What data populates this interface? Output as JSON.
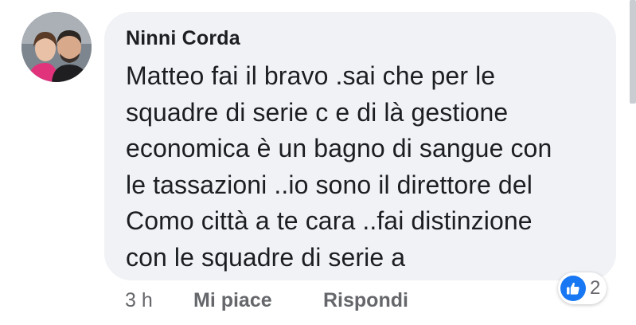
{
  "comment": {
    "author": "Ninni Corda",
    "text_lines": [
      "Matteo fai il bravo .sai che per le",
      "squadre di serie c e di là gestione",
      "economica è un bagno di sangue con",
      "le tassazioni ..io sono il direttore del",
      "Como città a te cara ..fai distinzione",
      "con le squadre di serie a"
    ],
    "timestamp": "3 h",
    "like_label": "Mi piace",
    "reply_label": "Rispondi",
    "reaction_count": "2",
    "reaction_icon": "thumbs-up-icon",
    "colors": {
      "bubble": "#f0f2f5",
      "text": "#1c1e21",
      "meta": "#65676b",
      "like_blue": "#1877f2"
    }
  }
}
